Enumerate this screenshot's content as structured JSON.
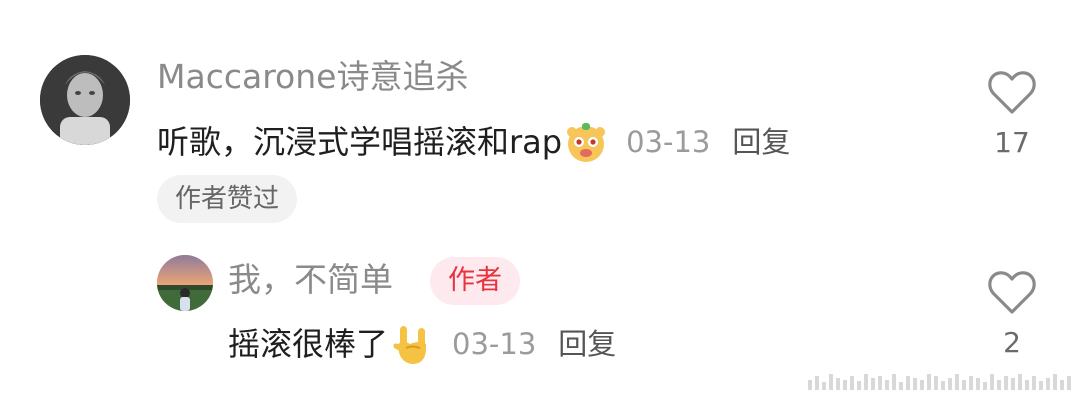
{
  "comments": [
    {
      "username": "Maccarone诗意追杀",
      "text": "听歌，沉浸式学唱摇滚和rap",
      "emoji": "bear-face-emoji",
      "date": "03-13",
      "reply_label": "回复",
      "like_count": "17",
      "liked_by_author_label": "作者赞过"
    },
    {
      "username": "我，不简单",
      "author_badge": "作者",
      "text": "摇滚很棒了",
      "emoji": "rock-on-hand-emoji",
      "date": "03-13",
      "reply_label": "回复",
      "like_count": "2"
    }
  ],
  "colors": {
    "username": "#8a8a8a",
    "author_badge_text": "#e8333f",
    "author_badge_bg": "#fde9ee",
    "badge_bg": "#f2f2f2"
  }
}
